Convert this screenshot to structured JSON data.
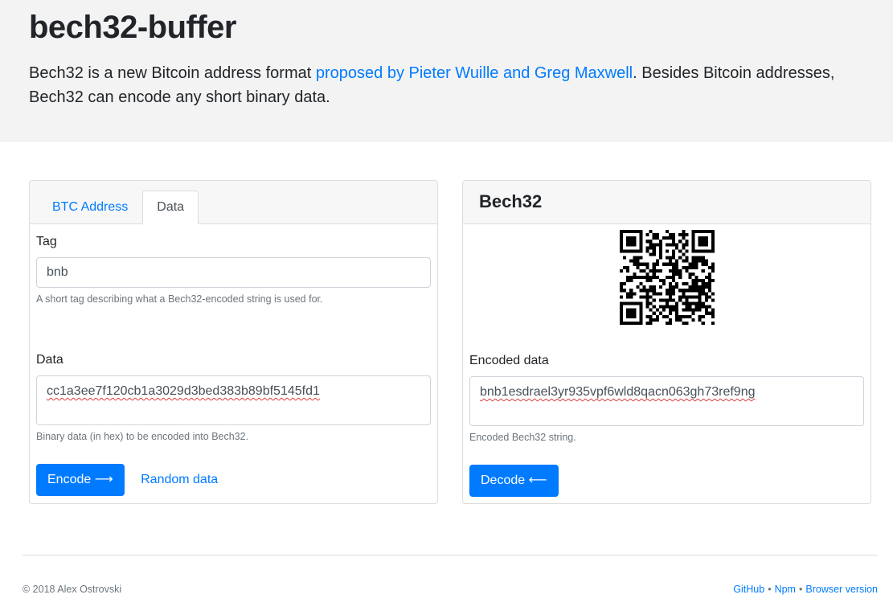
{
  "header": {
    "title": "bech32-buffer",
    "desc_before": "Bech32 is a new Bitcoin address format ",
    "desc_link": "proposed by Pieter Wuille and Greg Maxwell",
    "desc_after": ". Besides Bitcoin addresses, Bech32 can encode any short binary data."
  },
  "left_card": {
    "tabs": [
      {
        "label": "BTC Address",
        "active": false
      },
      {
        "label": "Data",
        "active": true
      }
    ],
    "tag": {
      "label": "Tag",
      "value": "bnb",
      "help": "A short tag describing what a Bech32-encoded string is used for."
    },
    "data": {
      "label": "Data",
      "value": "cc1a3ee7f120cb1a3029d3bed383b89bf5145fd1",
      "help": "Binary data (in hex) to be encoded into Bech32."
    },
    "encode_button": "Encode ⟶",
    "random_link": "Random data"
  },
  "right_card": {
    "title": "Bech32",
    "encoded": {
      "label": "Encoded data",
      "value": "bnb1esdrael3yr935vpf6wld8qacn063gh73ref9ng",
      "help": "Encoded Bech32 string."
    },
    "decode_button": "Decode ⟵"
  },
  "footer": {
    "copyright": "© 2018 Alex Ostrovski",
    "links": [
      "GitHub",
      "Npm",
      "Browser version"
    ],
    "separator": "•"
  },
  "colors": {
    "accent": "#007bff",
    "jumbotron_bg": "#f3f3f3",
    "muted": "#6c757d"
  }
}
